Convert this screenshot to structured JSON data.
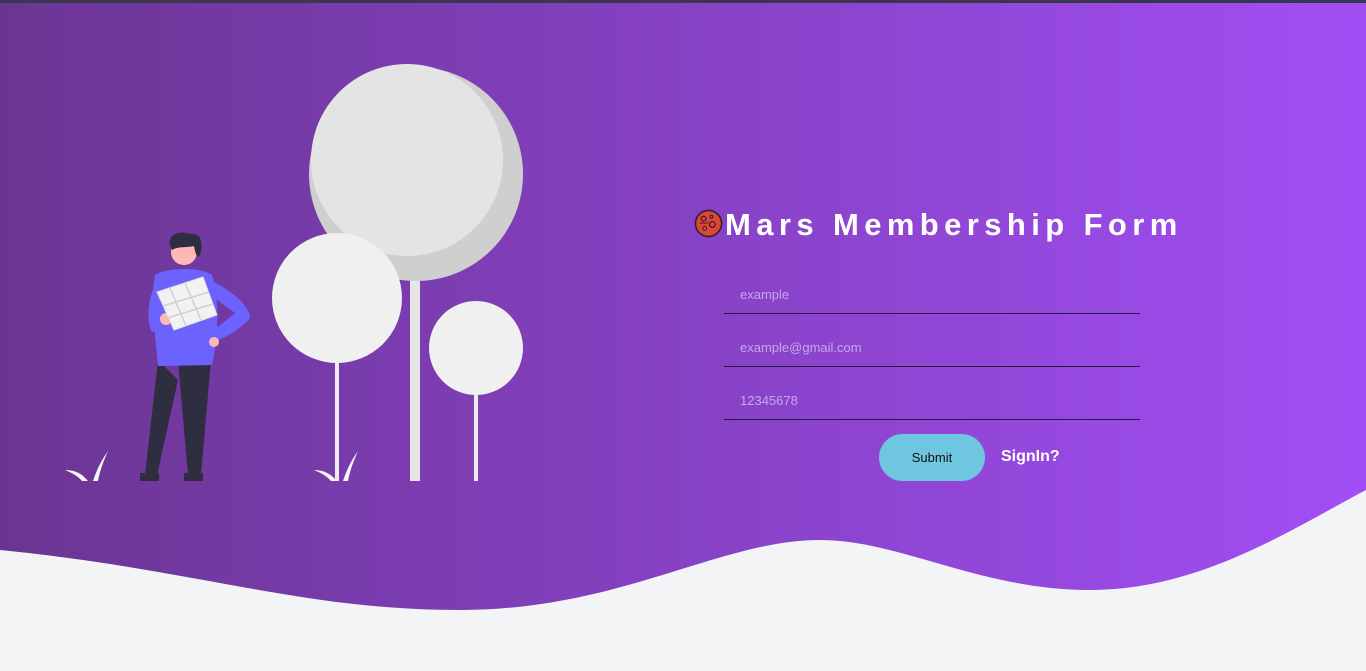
{
  "form": {
    "title": "Mars Membership Form",
    "name_placeholder": "example",
    "email_placeholder": "example@gmail.com",
    "password_placeholder": "12345678",
    "submit_label": "Submit",
    "signin_label": "SignIn?"
  },
  "colors": {
    "gradient_start": "#6a3592",
    "gradient_end": "#a24ef5",
    "wave_background": "#f3f4f6",
    "submit_button": "#6ec6e0",
    "title_text": "#ffffff"
  },
  "icons": {
    "title_icon": "mars-planet-icon",
    "illustration": "person-reading-map-with-trees"
  }
}
